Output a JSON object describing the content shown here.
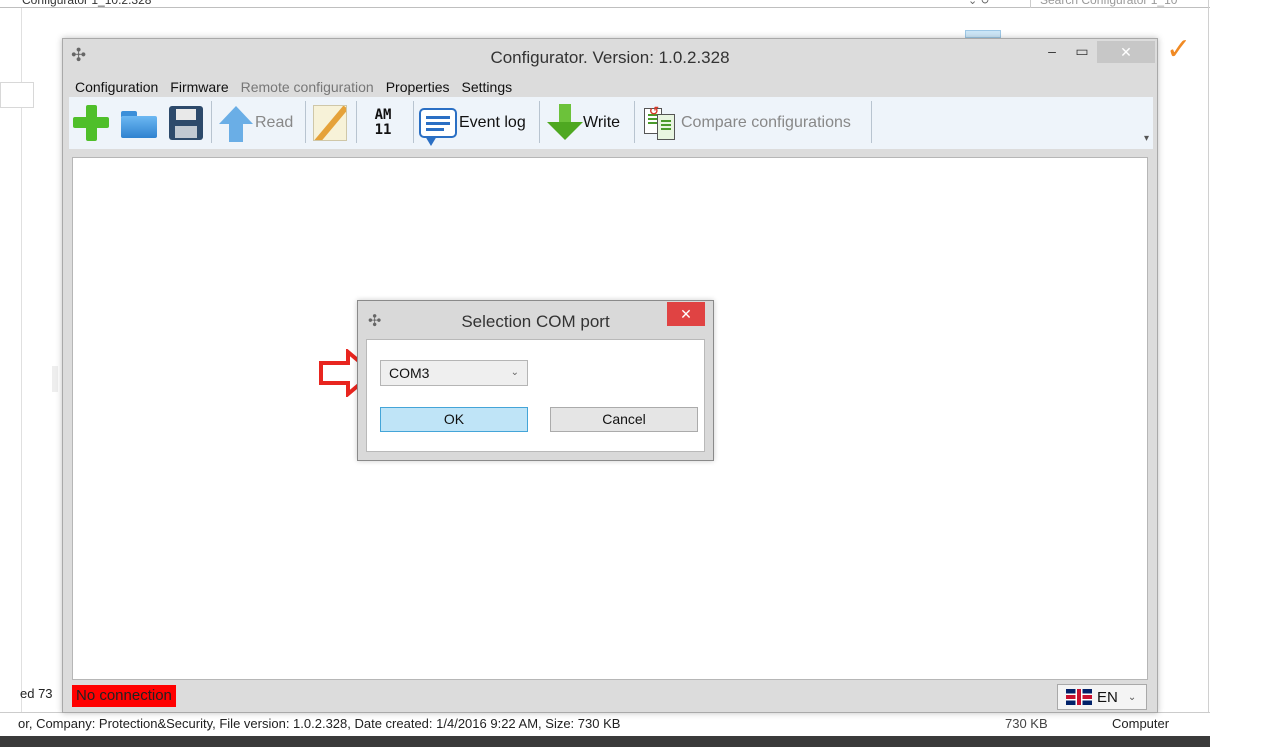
{
  "app": {
    "title": "Configurator. Version: 1.0.2.328",
    "minimize_glyph": "–",
    "maximize_glyph": "▭",
    "close_glyph": "✕"
  },
  "menu": [
    {
      "label": "Configuration",
      "enabled": true
    },
    {
      "label": "Firmware",
      "enabled": true
    },
    {
      "label": "Remote configuration",
      "enabled": false
    },
    {
      "label": "Properties",
      "enabled": true
    },
    {
      "label": "Settings",
      "enabled": true
    }
  ],
  "toolbar": {
    "read_label": "Read",
    "am_line1": "AM",
    "am_line2": "11",
    "event_log_label": "Event log",
    "write_label": "Write",
    "compare_label": "Compare configurations",
    "overflow_glyph": "▾"
  },
  "status": {
    "connection": "No connection",
    "language": "EN",
    "connection_color": "#ff0000"
  },
  "dialog": {
    "title": "Selection COM port",
    "close_glyph": "✕",
    "selected_port": "COM3",
    "ok_label": "OK",
    "cancel_label": "Cancel"
  },
  "background": {
    "ed_text": "ed 73",
    "status_left": "or, Company: Protection&Security, File version: 1.0.2.328, Date created: 1/4/2016 9:22 AM, Size: 730 KB",
    "status_size": "730 KB",
    "status_computer": "Computer"
  }
}
